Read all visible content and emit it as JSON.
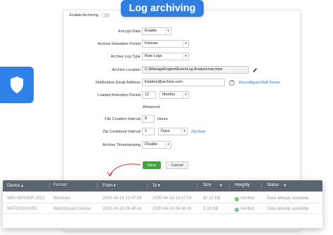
{
  "header": {
    "title": "Log archiving"
  },
  "enable_archiving": {
    "label": "Enable Archiving",
    "state": "off"
  },
  "form": {
    "encrypt": {
      "label": "Encrypt Data",
      "value": "Enable"
    },
    "retention": {
      "label": "Archive Retention Period",
      "value": "Forever"
    },
    "log_type": {
      "label": "Archive Log Type",
      "value": "Raw Logs"
    },
    "location": {
      "label": "Archive Location",
      "value": "C:\\ManageEngine\\EventLog Analyzer\\archive"
    },
    "email": {
      "label": "Notification Email Address",
      "value": "Eladmo@archive.com",
      "link": "Reconfigure Mail Server"
    },
    "loaded_retention": {
      "label": "Loaded Retention Period",
      "number": "12",
      "unit": "Months"
    },
    "advanced": {
      "label": "Advanced"
    },
    "file_creation": {
      "label": "File Creation Interval",
      "number": "8",
      "unit": "Hours"
    },
    "zip_interval": {
      "label": "Zip Creational Interval",
      "number": "1",
      "unit": "Days",
      "link": "Zip Now"
    },
    "timestamping": {
      "label": "Archive Timestamping",
      "value": "Disable"
    }
  },
  "buttons": {
    "save": "Save",
    "cancel": "Cancel"
  },
  "table": {
    "columns": [
      "Device",
      "Format",
      "From",
      "To",
      "Size",
      "Integrity",
      "Status"
    ],
    "rows": [
      {
        "device": "WIN-SERVER-2012",
        "format": "Windows",
        "from": "2020-04-14 13:47:04",
        "to": "2020-04-14 13:47:04",
        "size": "92.12 KB",
        "integrity": "Verified",
        "status": "Data already available."
      },
      {
        "device": "WATCHGUARD",
        "format": "WatchGuard Device",
        "from": "2020-04-16 06:48:41",
        "to": "2020-04-16 06:48:41",
        "size": "5.33 KB",
        "integrity": "Verified",
        "status": "Data already available."
      }
    ]
  },
  "colors": {
    "accent": "#2f7fe0",
    "save": "#43a33f",
    "table_header": "#5b6570",
    "link": "#2b6fd6"
  }
}
